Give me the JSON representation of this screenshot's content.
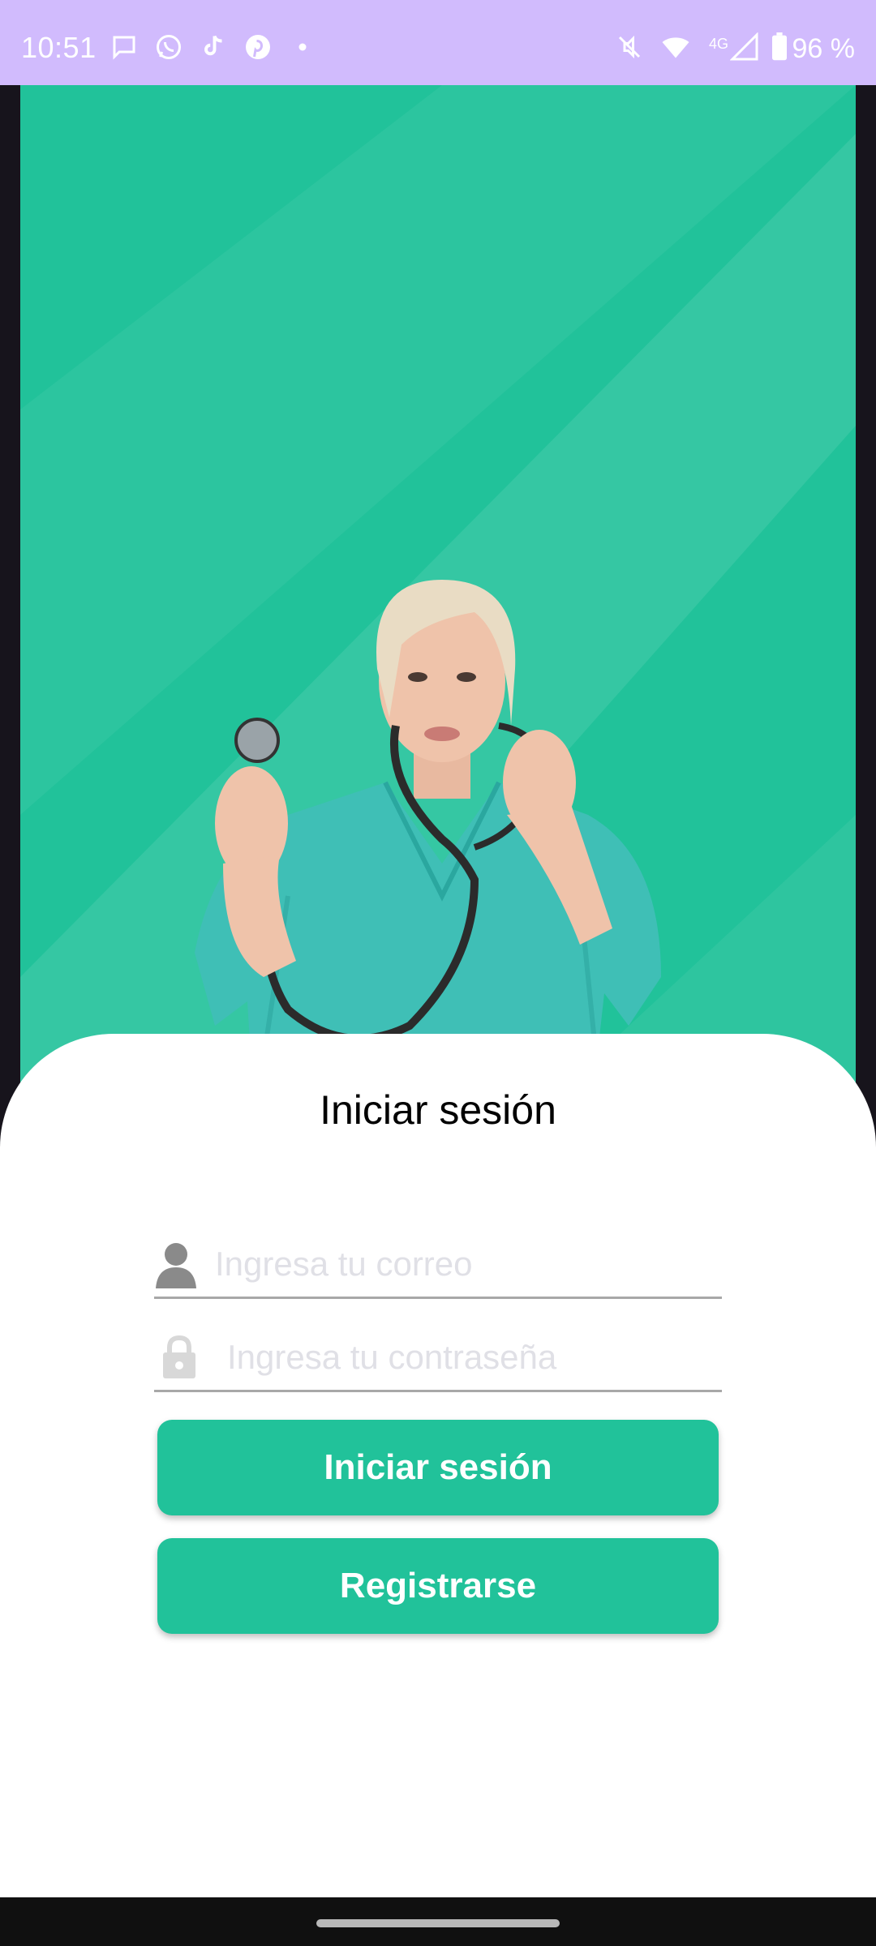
{
  "status_bar": {
    "time": "10:51",
    "battery": "96 %",
    "network": "4G",
    "icons_left": [
      "message-icon",
      "whatsapp-icon",
      "tiktok-icon",
      "pinterest-icon",
      "dot-icon"
    ],
    "icons_right": [
      "mute-icon",
      "wifi-icon",
      "signal-icon",
      "battery-icon"
    ]
  },
  "login": {
    "title": "Iniciar sesión",
    "email_placeholder": "Ingresa tu correo",
    "password_placeholder": "Ingresa tu contraseña",
    "login_button": "Iniciar sesión",
    "register_button": "Registrarse"
  },
  "colors": {
    "accent": "#21c29a",
    "status_bar": "#d1bbfd",
    "scrub_top": "#3fbfb6"
  }
}
